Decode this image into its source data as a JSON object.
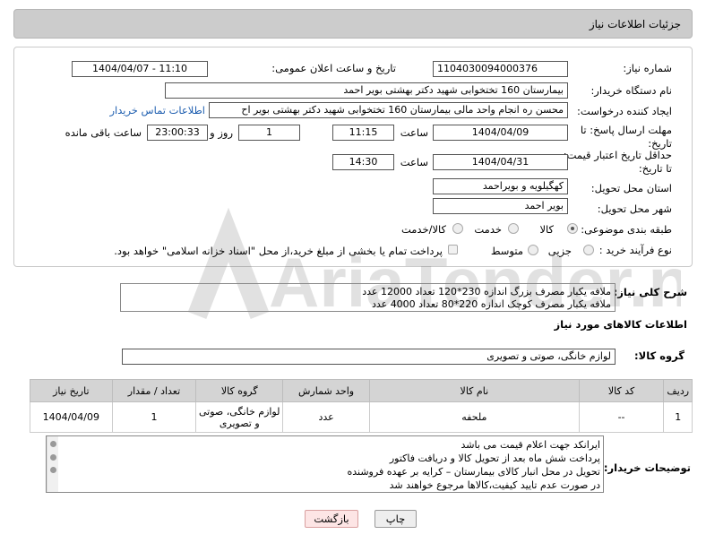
{
  "header": {
    "title": "جزئیات اطلاعات نیاز"
  },
  "labels": {
    "need_no": "شماره نیاز:",
    "pub_date": "تاریخ و ساعت اعلان عمومی:",
    "buyer": "نام دستگاه خریدار:",
    "creator": "ایجاد کننده درخواست:",
    "deadline": "مهلت ارسال پاسخ: تا تاریخ:",
    "time1": "ساعت",
    "day": "روز و",
    "remaining": "ساعت باقی مانده",
    "min_valid": "حداقل تاریخ اعتبار قیمت: تا تاریخ:",
    "time2": "ساعت",
    "province": "استان محل تحویل:",
    "city": "شهر محل تحویل:",
    "category": "طبقه بندی موضوعی:",
    "process": "نوع فرآیند خرید :"
  },
  "values": {
    "need_no": "1104030094000376",
    "pub_date": "1404/04/07 - 11:10",
    "buyer": "بیمارستان 160 تختخوابی شهید دکتر بهشتی بویر احمد",
    "creator": "محسن ره انجام واحد مالی بیمارستان 160 تختخوابی شهید دکتر بهشتی بویر اح",
    "contact_link": "اطلاعات تماس خریدار",
    "deadline_date": "1404/04/09",
    "deadline_time": "11:15",
    "days": "1",
    "remaining_time": "23:00:33",
    "valid_date": "1404/04/31",
    "valid_time": "14:30",
    "province": "کهگیلویه و بویراحمد",
    "city": "بویر احمد"
  },
  "category_options": [
    "کالا",
    "خدمت",
    "کالا/خدمت"
  ],
  "process_options": [
    "جزیی",
    "متوسط"
  ],
  "payment_note": "پرداخت تمام یا بخشی از مبلغ خرید،از محل \"اسناد خزانه اسلامی\" خواهد بود.",
  "description": {
    "label": "شرح کلی نیاز:",
    "lines": [
      "ملافه یکبار مصرف بزرگ اندازه 230*120 تعداد 12000 عدد",
      "ملافه یکبار مصرف کوچک اندازه 220*80 تعداد 4000 عدد"
    ]
  },
  "goods_info_title": "اطلاعات کالاهای مورد نیاز",
  "goods_group": {
    "label": "گروه کالا:",
    "value": "لوازم خانگی، صوتی و تصویری"
  },
  "table": {
    "headers": [
      "ردیف",
      "کد کالا",
      "نام کالا",
      "واحد شمارش",
      "گروه کالا",
      "تعداد / مقدار",
      "تاریخ نیاز"
    ],
    "rows": [
      {
        "row": "1",
        "code": "--",
        "name": "ملحفه",
        "unit": "عدد",
        "group": "لوازم خانگی، صوتی و تصویری",
        "qty": "1",
        "date": "1404/04/09"
      }
    ]
  },
  "buyer_notes": {
    "label": "توضیحات خریدار:",
    "lines": [
      "ایرانکد جهت اعلام قیمت می باشد",
      "پرداخت شش ماه بعد از تحویل کالا و دریافت فاکتور",
      "تحویل در محل انبار کالای بیمارستان – کرایه بر عهده فروشنده",
      "در صورت عدم تایید کیفیت،کالاها مرجوع خواهند شد"
    ]
  },
  "buttons": {
    "print": "چاپ",
    "back": "بازگشت"
  }
}
